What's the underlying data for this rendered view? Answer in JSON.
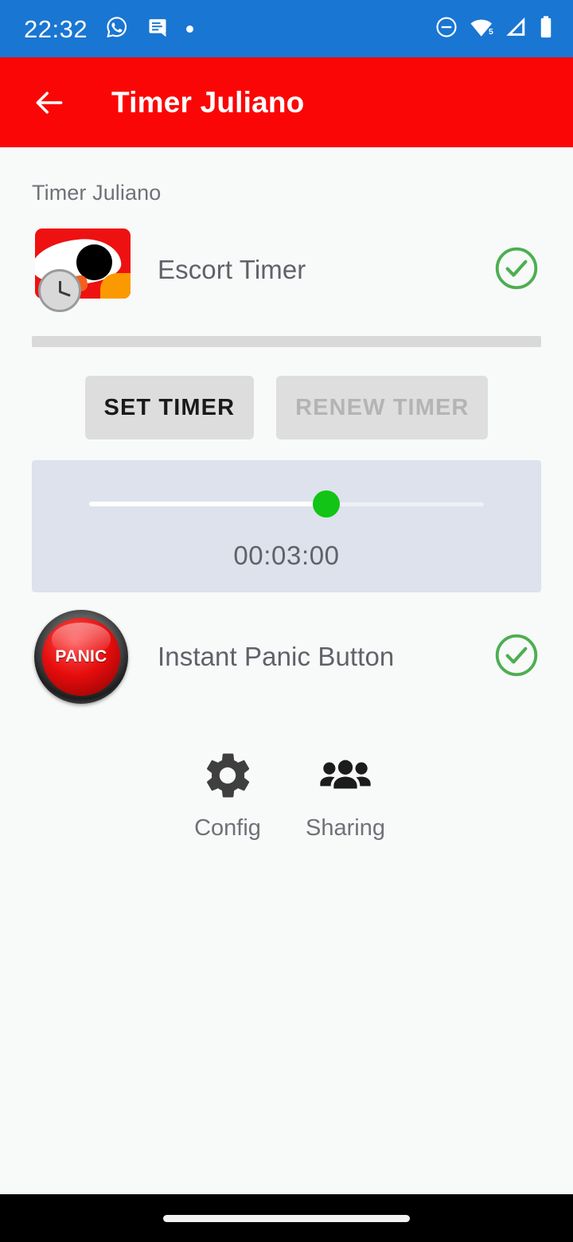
{
  "status_bar": {
    "time": "22:32",
    "background_color": "#1976d2",
    "icons": [
      {
        "name": "whatsapp-icon"
      },
      {
        "name": "message-note-icon"
      },
      {
        "name": "dot-indicator-icon"
      },
      {
        "name": "do-not-disturb-icon"
      },
      {
        "name": "wifi-icon",
        "badge": "5"
      },
      {
        "name": "cellular-signal-icon"
      },
      {
        "name": "battery-icon"
      }
    ]
  },
  "app_bar": {
    "back_icon": "arrow-left-icon",
    "title": "Timer Juliano",
    "background_color": "#fb0606",
    "text_color": "#ffffff"
  },
  "content": {
    "section_label": "Timer Juliano",
    "escort": {
      "icon_name": "escort-timer-app-icon",
      "label": "Escort Timer",
      "status_icon": "check-circle-icon",
      "status_color": "#4caf50",
      "enabled": true
    },
    "progress_bar": {
      "name": "timer-progress-bar",
      "fill_percent": 0,
      "track_color": "#d9d9d9"
    },
    "buttons": {
      "set_timer": {
        "label": "SET TIMER",
        "enabled": true
      },
      "renew_timer": {
        "label": "RENEW TIMER",
        "enabled": false
      }
    },
    "duration_slider": {
      "name": "timer-duration-slider",
      "value_label": "00:03:00",
      "fill_percent": 60,
      "thumb_color": "#12c415",
      "panel_color": "#dde2ec"
    },
    "panic": {
      "icon_name": "instant-panic-button-icon",
      "icon_text": "PANIC",
      "label": "Instant Panic Button",
      "status_icon": "check-circle-icon",
      "status_color": "#4caf50",
      "enabled": true
    },
    "actions": [
      {
        "icon": "gear-icon",
        "label": "Config"
      },
      {
        "icon": "people-group-icon",
        "label": "Sharing"
      }
    ]
  },
  "nav_bar": {
    "gesture_pill": "home-gesture-pill"
  }
}
